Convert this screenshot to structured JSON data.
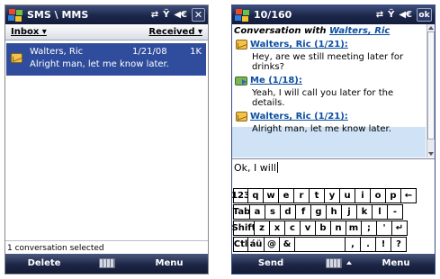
{
  "screenA": {
    "title": "SMS \\ MMS",
    "list_header": {
      "left": "Inbox ▾",
      "right": "Received ▾"
    },
    "message": {
      "sender": "Walters, Ric",
      "date": "1/21/08",
      "size": "1K",
      "preview": "Alright man, let me know later."
    },
    "status": "1 conversation selected",
    "softkeys": {
      "left": "Delete",
      "right": "Menu"
    }
  },
  "screenB": {
    "title": "10/160",
    "ok": "ok",
    "conversation_header_prefix": "Conversation with",
    "conversation_header_name": "Walters, Ric",
    "messages": [
      {
        "from": "Walters, Ric (1/21):",
        "text_line1": "Hey, are we still meeting later for",
        "text_line2": "drinks?"
      },
      {
        "from": "Me (1/18):",
        "text_line1": "Yeah, I will call you later for the",
        "text_line2": "details."
      },
      {
        "from": "Walters, Ric (1/21):",
        "text_line1": "Alright man, let me know later.",
        "text_line2": ""
      }
    ],
    "input_value": "Ok, I will",
    "keyboard_rows": [
      [
        "123",
        "q",
        "w",
        "e",
        "r",
        "t",
        "y",
        "u",
        "i",
        "o",
        "p",
        "←"
      ],
      [
        "Tab",
        "a",
        "s",
        "d",
        "f",
        "g",
        "h",
        "j",
        "k",
        "l",
        "-"
      ],
      [
        "Shift",
        "z",
        "x",
        "c",
        "v",
        "b",
        "n",
        "m",
        ";",
        "'",
        "↵"
      ],
      [
        "Ctl",
        "áü",
        "@",
        "&",
        "",
        ",",
        ".",
        "!",
        "?"
      ]
    ],
    "softkeys": {
      "left": "Send",
      "right": "Menu"
    }
  },
  "icons": {
    "start": "windows-logo-icon",
    "connectivity": "connectivity-arrows-icon",
    "signal": "signal-icon",
    "volume": "volume-icon",
    "close": "close-icon",
    "message": "envelope-icon",
    "sent": "sent-message-icon",
    "keyboard": "keyboard-icon"
  },
  "colors": {
    "titlebar": "#1c264a",
    "selection": "#2f4d9c",
    "link": "#0b4ea2",
    "highlight": "#cfe2f6"
  }
}
